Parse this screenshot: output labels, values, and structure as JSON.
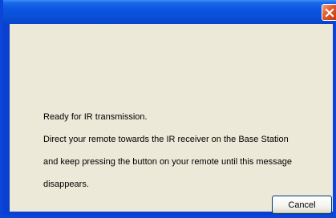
{
  "dialog": {
    "message_lines": [
      "Ready for IR transmission.",
      "Direct your remote towards the IR receiver on the Base Station",
      "and keep pressing the button on your remote until this message",
      "disappears."
    ],
    "cancel_label": "Cancel"
  },
  "icons": {
    "close": "close-icon"
  },
  "colors": {
    "titlebar": "#0a55e0",
    "client_background": "#ece9d8",
    "close_button": "#e2572a"
  }
}
